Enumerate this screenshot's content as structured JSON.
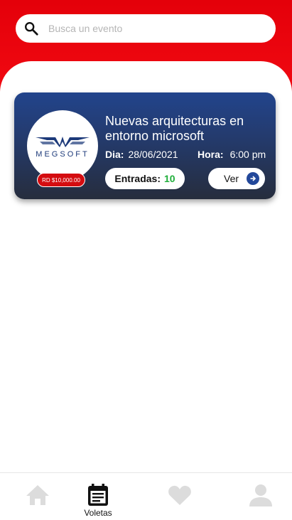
{
  "search": {
    "placeholder": "Busca un evento"
  },
  "event": {
    "title": "Nuevas arquitecturas en entorno microsoft",
    "organizer_logo": "MEGSOFT",
    "price": "RD $10,000.00",
    "date_label": "Dia:",
    "date_value": "28/06/2021",
    "time_label": "Hora:",
    "time_value": "6:00 pm",
    "tickets_label": "Entradas:",
    "tickets_count": "10",
    "view_label": "Ver"
  },
  "nav": {
    "items": [
      {
        "label": "",
        "icon": "home-icon",
        "active": false
      },
      {
        "label": "Voletas",
        "icon": "ticket-calendar-icon",
        "active": true
      },
      {
        "label": "",
        "icon": "heart-icon",
        "active": false
      },
      {
        "label": "",
        "icon": "person-icon",
        "active": false
      }
    ]
  },
  "colors": {
    "brand_red": "#e4000a",
    "card_blue": "#22448c",
    "tickets_green": "#1fae3a",
    "price_red": "#d40c10",
    "inactive_icon": "#dcdcdc"
  }
}
